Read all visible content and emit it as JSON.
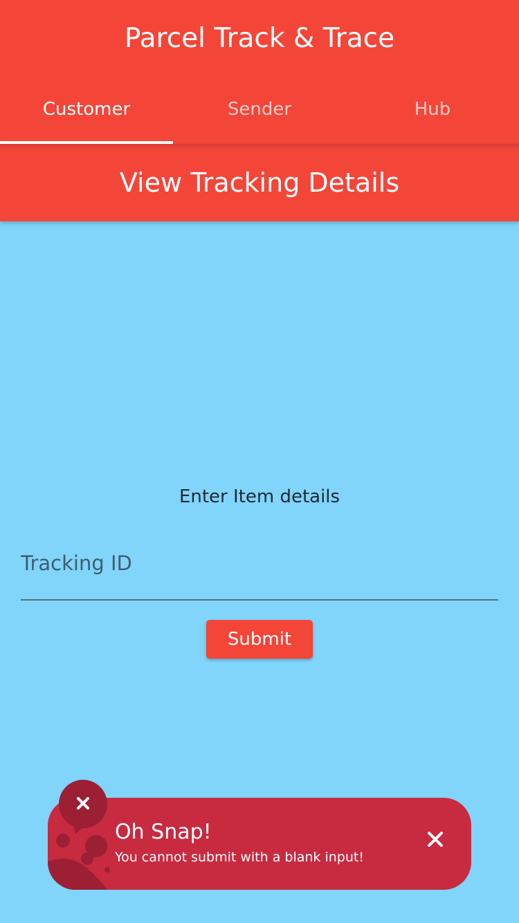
{
  "app": {
    "title": "Parcel Track & Trace"
  },
  "tabs": [
    {
      "label": "Customer",
      "active": true
    },
    {
      "label": "Sender",
      "active": false
    },
    {
      "label": "Hub",
      "active": false
    }
  ],
  "page": {
    "heading": "View Tracking Details",
    "prompt": "Enter Item details"
  },
  "form": {
    "tracking_placeholder": "Tracking ID",
    "tracking_value": "",
    "submit_label": "Submit"
  },
  "snackbar": {
    "title": "Oh Snap!",
    "message": "You cannot submit with a blank input!",
    "badge_icon": "close-icon",
    "dismiss_icon": "close-icon"
  },
  "colors": {
    "primary": "#f44539",
    "background": "#81d4fa",
    "error": "#c82a40",
    "error_dark": "#9c1f34"
  }
}
